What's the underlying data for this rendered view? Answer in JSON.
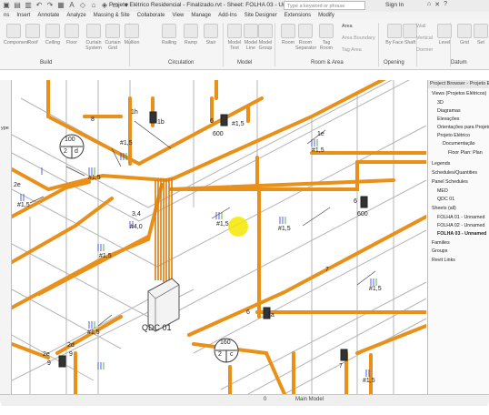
{
  "titlebar": {
    "title": "Projeto Elétrico Residencial - Finalizado.rvt - Sheet: FOLHA 03 - Unnamed",
    "search_placeholder": "Type a keyword or phrase",
    "signin": "Sign In"
  },
  "menu": [
    "ns",
    "Insert",
    "Annotate",
    "Analyze",
    "Massing & Site",
    "Collaborate",
    "View",
    "Manage",
    "Add-Ins",
    "Site Designer",
    "Extensions",
    "Modify"
  ],
  "ribbon": {
    "buttons": [
      "Component",
      "Roof",
      "Ceiling",
      "Floor",
      "Curtain System",
      "Curtain Grid",
      "Mullion",
      "Railing",
      "Ramp",
      "Stair",
      "Model Text",
      "Model Line",
      "Model Group",
      "Room",
      "Room Separator",
      "Tag Room",
      "By Face",
      "Shaft",
      "Level",
      "Grid",
      "Set"
    ],
    "groups": [
      "Build",
      "Circulation",
      "Model",
      "Room & Area",
      "Opening",
      "Datum"
    ],
    "room_area_items": [
      "Area",
      "Area Boundary",
      "Tag Area"
    ],
    "opening_items": [
      "Wall",
      "Vertical",
      "Dormer"
    ]
  },
  "left_panel": {
    "label": "ype"
  },
  "canvas": {
    "tags": [
      {
        "name": "tag-1h",
        "text": "1h"
      },
      {
        "name": "tag-1b",
        "text": "1b"
      },
      {
        "name": "tag-6-600-top",
        "text": "6"
      },
      {
        "name": "tag-600-top",
        "text": "600"
      },
      {
        "name": "tag-100",
        "text": "100"
      },
      {
        "name": "tag-2",
        "text": "2"
      },
      {
        "name": "tag-d",
        "text": "d"
      },
      {
        "name": "tag-1e",
        "text": "1e"
      },
      {
        "name": "tag-8",
        "text": "8"
      },
      {
        "name": "tag-6-600-right",
        "text": "6"
      },
      {
        "name": "tag-600-right",
        "text": "600"
      },
      {
        "name": "tag-qdc",
        "text": "QDC 01"
      },
      {
        "name": "tag-6-1a",
        "text": "6"
      },
      {
        "name": "tag-1a",
        "text": "1a"
      },
      {
        "name": "tag-160",
        "text": "160"
      },
      {
        "name": "tag-2-c",
        "text": "2"
      },
      {
        "name": "tag-c",
        "text": "c"
      },
      {
        "name": "tag-2e",
        "text": "2e"
      },
      {
        "name": "tag-9a",
        "text": "9"
      },
      {
        "name": "tag-2d",
        "text": "2d"
      },
      {
        "name": "tag-9b",
        "text": "9"
      },
      {
        "name": "tag-7",
        "text": "7"
      },
      {
        "name": "tag-2e-left",
        "text": "2e"
      },
      {
        "name": "tag-7-left",
        "text": "7"
      },
      {
        "name": "tag-3-4",
        "text": "3,4"
      },
      {
        "name": "tag-4-0",
        "text": "#4,0"
      }
    ],
    "wire_labels": [
      "#1,5",
      "#1,5",
      "#1,5",
      "#1,5",
      "#1,5",
      "#1,5",
      "#1,5",
      "#1,5",
      "#1,5",
      "#1,5",
      "#1,5"
    ]
  },
  "browser": {
    "header": "Project Browser - Projeto Elétrico",
    "items": [
      {
        "text": "Views (Projetos Elétricos)",
        "indent": 0,
        "bold": false
      },
      {
        "text": "3D",
        "indent": 1,
        "bold": false
      },
      {
        "text": "Diagramas",
        "indent": 1,
        "bold": false
      },
      {
        "text": "Elevações",
        "indent": 1,
        "bold": false
      },
      {
        "text": "Orientações para Projeto",
        "indent": 1,
        "bold": false
      },
      {
        "text": "Projeto Elétrico",
        "indent": 1,
        "bold": false
      },
      {
        "text": "Documentação",
        "indent": 2,
        "bold": false
      },
      {
        "text": "Floor Plan: Plan",
        "indent": 3,
        "bold": false
      },
      {
        "text": "Legends",
        "indent": 0,
        "bold": false
      },
      {
        "text": "Schedules/Quantities",
        "indent": 0,
        "bold": false
      },
      {
        "text": "Panel Schedules",
        "indent": 0,
        "bold": false
      },
      {
        "text": "MED",
        "indent": 1,
        "bold": false
      },
      {
        "text": "QDC 01",
        "indent": 1,
        "bold": false
      },
      {
        "text": "Sheets (all)",
        "indent": 0,
        "bold": false
      },
      {
        "text": "FOLHA 01 - Unnamed",
        "indent": 1,
        "bold": false
      },
      {
        "text": "FOLHA 02 - Unnamed",
        "indent": 1,
        "bold": false
      },
      {
        "text": "FOLHA 03 - Unnamed",
        "indent": 1,
        "bold": true
      },
      {
        "text": "Families",
        "indent": 0,
        "bold": false
      },
      {
        "text": "Groups",
        "indent": 0,
        "bold": false
      },
      {
        "text": "Revit Links",
        "indent": 0,
        "bold": false
      }
    ]
  },
  "status": {
    "model": "Main Model",
    "scale": "0"
  },
  "colors": {
    "conduit": "#e8901a",
    "conduit_dark": "#b96a0a",
    "cursor": "#f6e800",
    "walls": "#b0b0b0"
  }
}
